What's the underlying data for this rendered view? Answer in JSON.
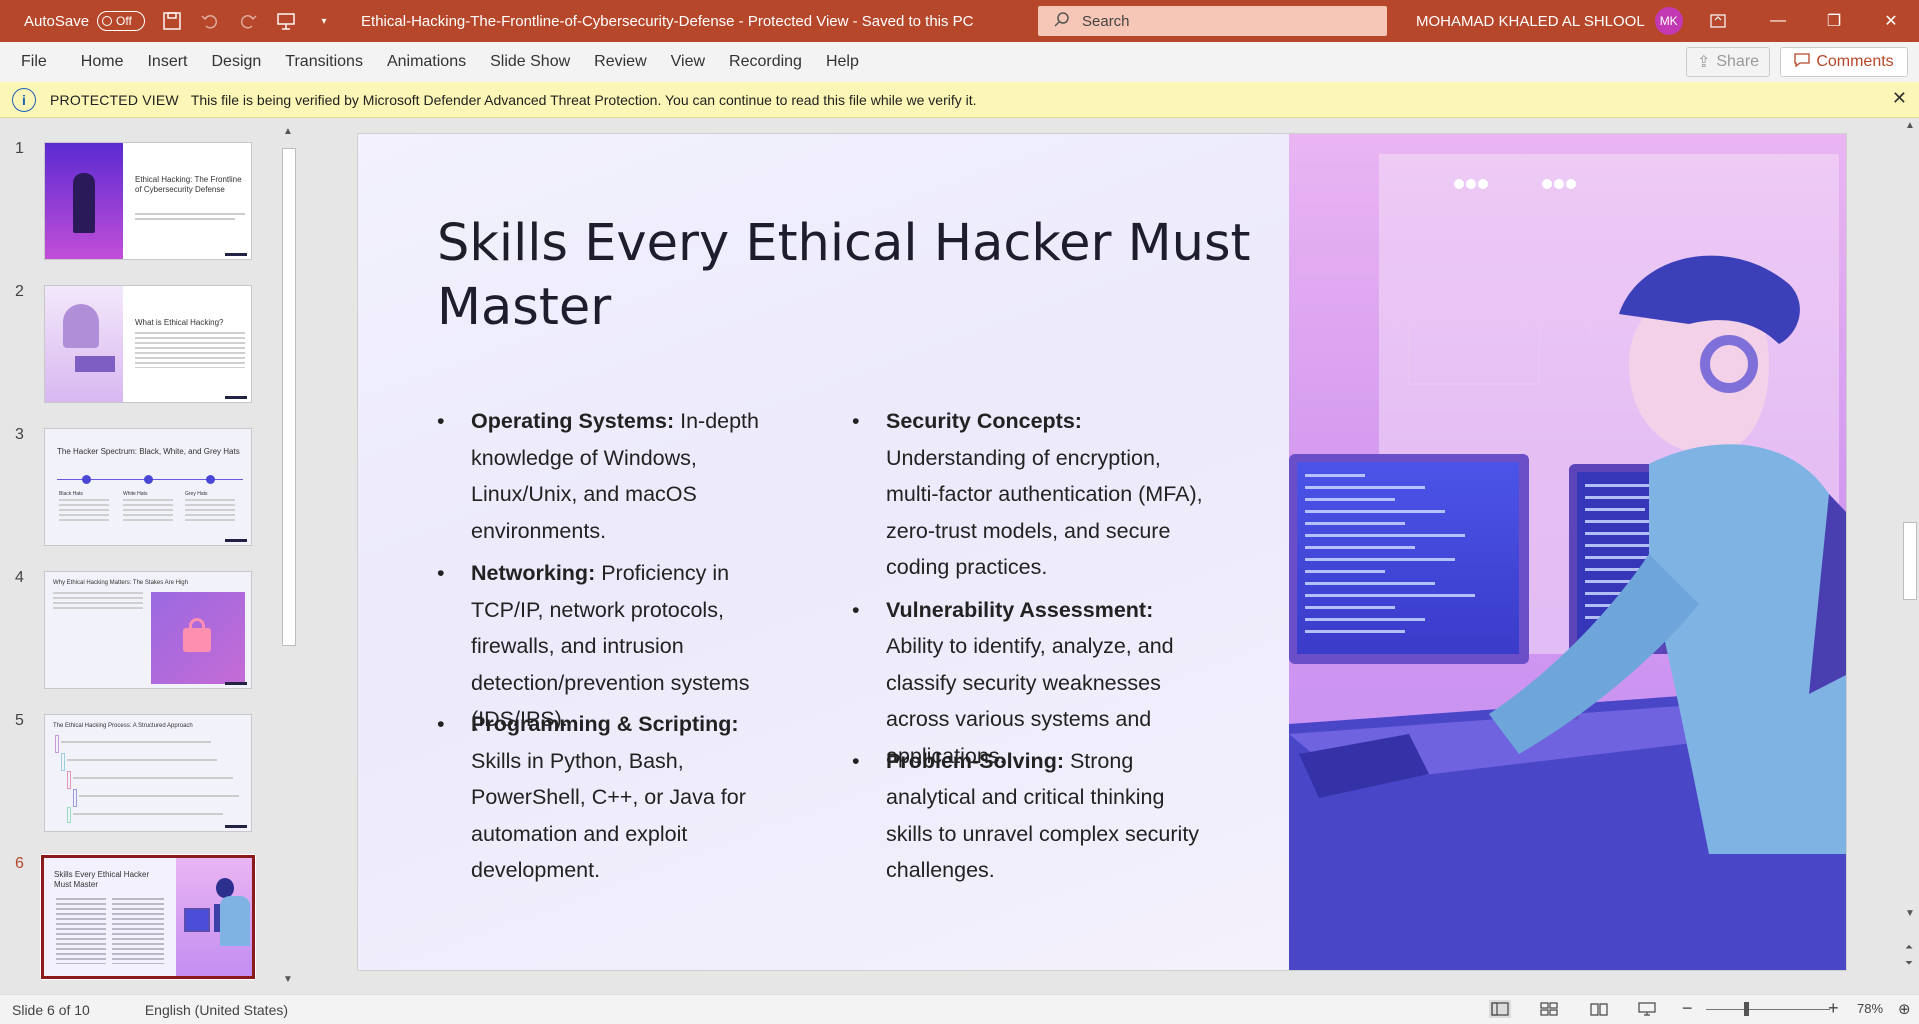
{
  "titlebar": {
    "autosave_label": "AutoSave",
    "autosave_state": "Off",
    "document_title": "Ethical-Hacking-The-Frontline-of-Cybersecurity-Defense  -  Protected View  -  Saved to this PC",
    "search_placeholder": "Search",
    "user_name": "MOHAMAD KHALED AL SHLOOL",
    "user_initials": "MK",
    "bg_color": "#b7472a"
  },
  "menu": {
    "items": [
      "File",
      "Home",
      "Insert",
      "Design",
      "Transitions",
      "Animations",
      "Slide Show",
      "Review",
      "View",
      "Recording",
      "Help"
    ],
    "share_label": "Share",
    "comments_label": "Comments"
  },
  "protected_view": {
    "title": "PROTECTED VIEW",
    "message": "This file is being verified by Microsoft Defender Advanced Threat Protection. You can continue to read this file while we verify it."
  },
  "thumbnails": [
    {
      "number": "1",
      "title": "Ethical Hacking: The Frontline of Cybersecurity Defense"
    },
    {
      "number": "2",
      "title": "What is Ethical Hacking?"
    },
    {
      "number": "3",
      "title": "The Hacker Spectrum: Black, White, and Grey Hats",
      "labels": [
        "Black Hats",
        "White Hats",
        "Grey Hats"
      ]
    },
    {
      "number": "4",
      "title": "Why Ethical Hacking Matters: The Stakes Are High"
    },
    {
      "number": "5",
      "title": "The Ethical Hacking Process: A Structured Approach"
    },
    {
      "number": "6",
      "title": "Skills Every Ethical Hacker Must Master"
    }
  ],
  "slide": {
    "title": "Skills Every Ethical Hacker Must Master",
    "left_column": [
      {
        "heading": "Operating Systems:",
        "text": " In-depth knowledge of Windows, Linux/Unix, and macOS environments."
      },
      {
        "heading": "Networking:",
        "text": " Proficiency in TCP/IP, network protocols, firewalls, and intrusion detection/prevention systems (IDS/IPS)."
      },
      {
        "heading": "Programming & Scripting:",
        "text": " Skills in Python, Bash, PowerShell, C++, or Java for automation and exploit development."
      }
    ],
    "right_column": [
      {
        "heading": "Security Concepts:",
        "text": " Understanding of encryption, multi-factor authentication (MFA), zero-trust models, and secure coding practices."
      },
      {
        "heading": "Vulnerability Assessment:",
        "text": " Ability to identify, analyze, and classify security weaknesses across various systems and applications."
      },
      {
        "heading": "Problem-Solving:",
        "text": " Strong analytical and critical thinking skills to unravel complex security challenges."
      }
    ]
  },
  "status": {
    "slide_indicator": "Slide 6 of 10",
    "language": "English (United States)",
    "zoom": "78%"
  }
}
